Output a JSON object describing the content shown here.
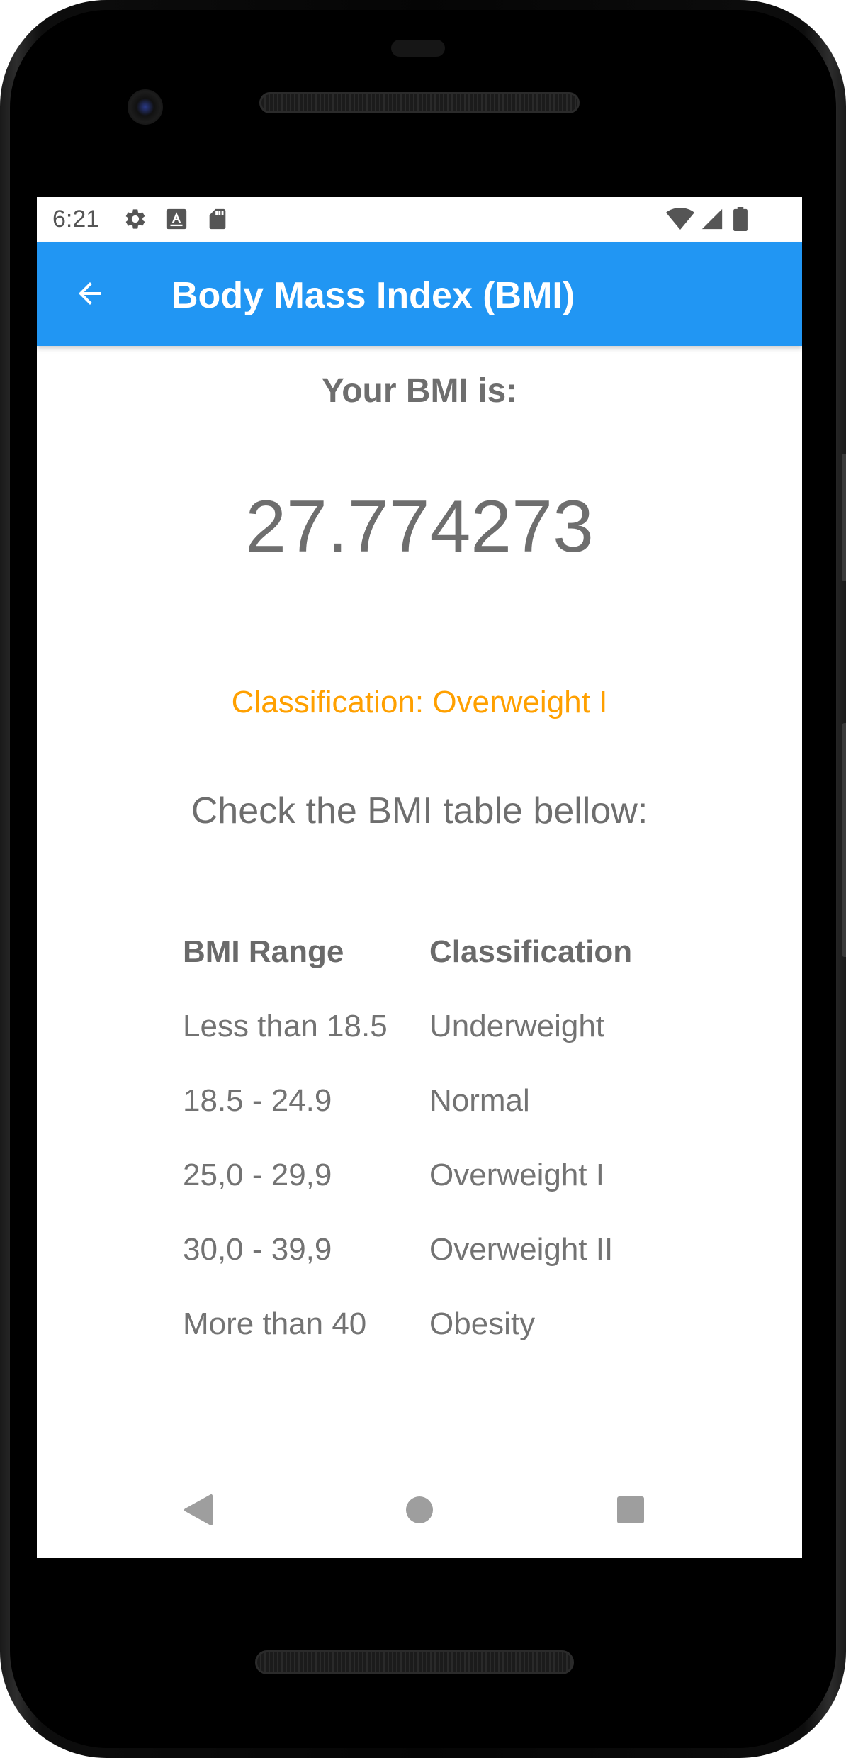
{
  "status_bar": {
    "time": "6:21",
    "left_icons": [
      "gear-icon",
      "text-a-icon",
      "sd-card-icon"
    ],
    "right_icons": [
      "wifi-icon",
      "signal-icon",
      "battery-icon"
    ]
  },
  "app_bar": {
    "back_icon": "arrow-left-icon",
    "title": "Body Mass Index (BMI)",
    "color": "#2196f3"
  },
  "result": {
    "heading": "Your BMI is:",
    "value": "27.774273",
    "classification": "Classification: Overweight I",
    "classification_color": "#ffa000"
  },
  "instruction": "Check the BMI table bellow:",
  "bmi_table": {
    "headers": [
      "BMI Range",
      "Classification"
    ],
    "rows": [
      [
        "Less than 18.5",
        "Underweight"
      ],
      [
        "18.5 - 24.9",
        "Normal"
      ],
      [
        "25,0 - 29,9",
        "Overweight I"
      ],
      [
        "30,0 - 39,9",
        "Overweight II"
      ],
      [
        "More than 40",
        "Obesity"
      ]
    ]
  },
  "nav_bar": {
    "buttons": [
      "back-triangle-icon",
      "home-circle-icon",
      "recents-square-icon"
    ]
  }
}
